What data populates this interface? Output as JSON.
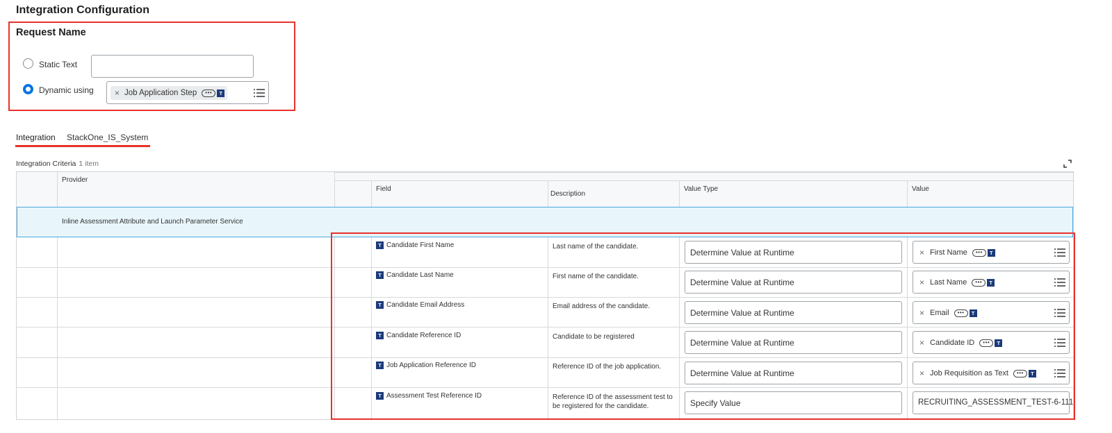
{
  "page": {
    "title": "Integration Configuration"
  },
  "request_name": {
    "title": "Request Name",
    "static_label": "Static Text",
    "static_value": "",
    "dynamic_label": "Dynamic using",
    "dynamic_pill": "Job Application Step",
    "more_glyph": "•••",
    "type_badge": "T",
    "remove_glyph": "×",
    "selected": "dynamic"
  },
  "tabs": [
    {
      "label": "Integration",
      "active": true
    },
    {
      "label": "StackOne_IS_System",
      "active": false
    }
  ],
  "criteria": {
    "label": "Integration Criteria",
    "count": "1 item"
  },
  "grid": {
    "headers": {
      "provider": "Provider",
      "field": "Field",
      "description": "Description",
      "value_type": "Value Type",
      "value": "Value"
    },
    "provider_row": "Inline Assessment Attribute and Launch Parameter Service",
    "rows": [
      {
        "field": "Candidate First Name",
        "description": "Last name of the candidate.",
        "value_type": "Determine Value at Runtime",
        "value": "First Name",
        "value_kind": "pill"
      },
      {
        "field": "Candidate Last Name",
        "description": "First name of the candidate.",
        "value_type": "Determine Value at Runtime",
        "value": "Last Name",
        "value_kind": "pill"
      },
      {
        "field": "Candidate Email Address",
        "description": "Email address of the candidate.",
        "value_type": "Determine Value at Runtime",
        "value": "Email",
        "value_kind": "pill"
      },
      {
        "field": "Candidate Reference ID",
        "description": "Candidate to be registered",
        "value_type": "Determine Value at Runtime",
        "value": "Candidate ID",
        "value_kind": "pill"
      },
      {
        "field": "Job Application Reference ID",
        "description": "Reference ID of the job application.",
        "value_type": "Determine Value at Runtime",
        "value": "Job Requisition as Text",
        "value_kind": "pill"
      },
      {
        "field": "Assessment Test Reference ID",
        "description": "Reference ID of the assessment test to be registered for the candidate.",
        "value_type": "Specify Value",
        "value": "RECRUITING_ASSESSMENT_TEST-6-111",
        "value_kind": "text"
      }
    ]
  },
  "colors": {
    "annotation_red": "#e8312a",
    "radio_selected": "#0875e1",
    "type_badge": "#1b3a7a",
    "row_highlight": "#e8f5fb"
  }
}
